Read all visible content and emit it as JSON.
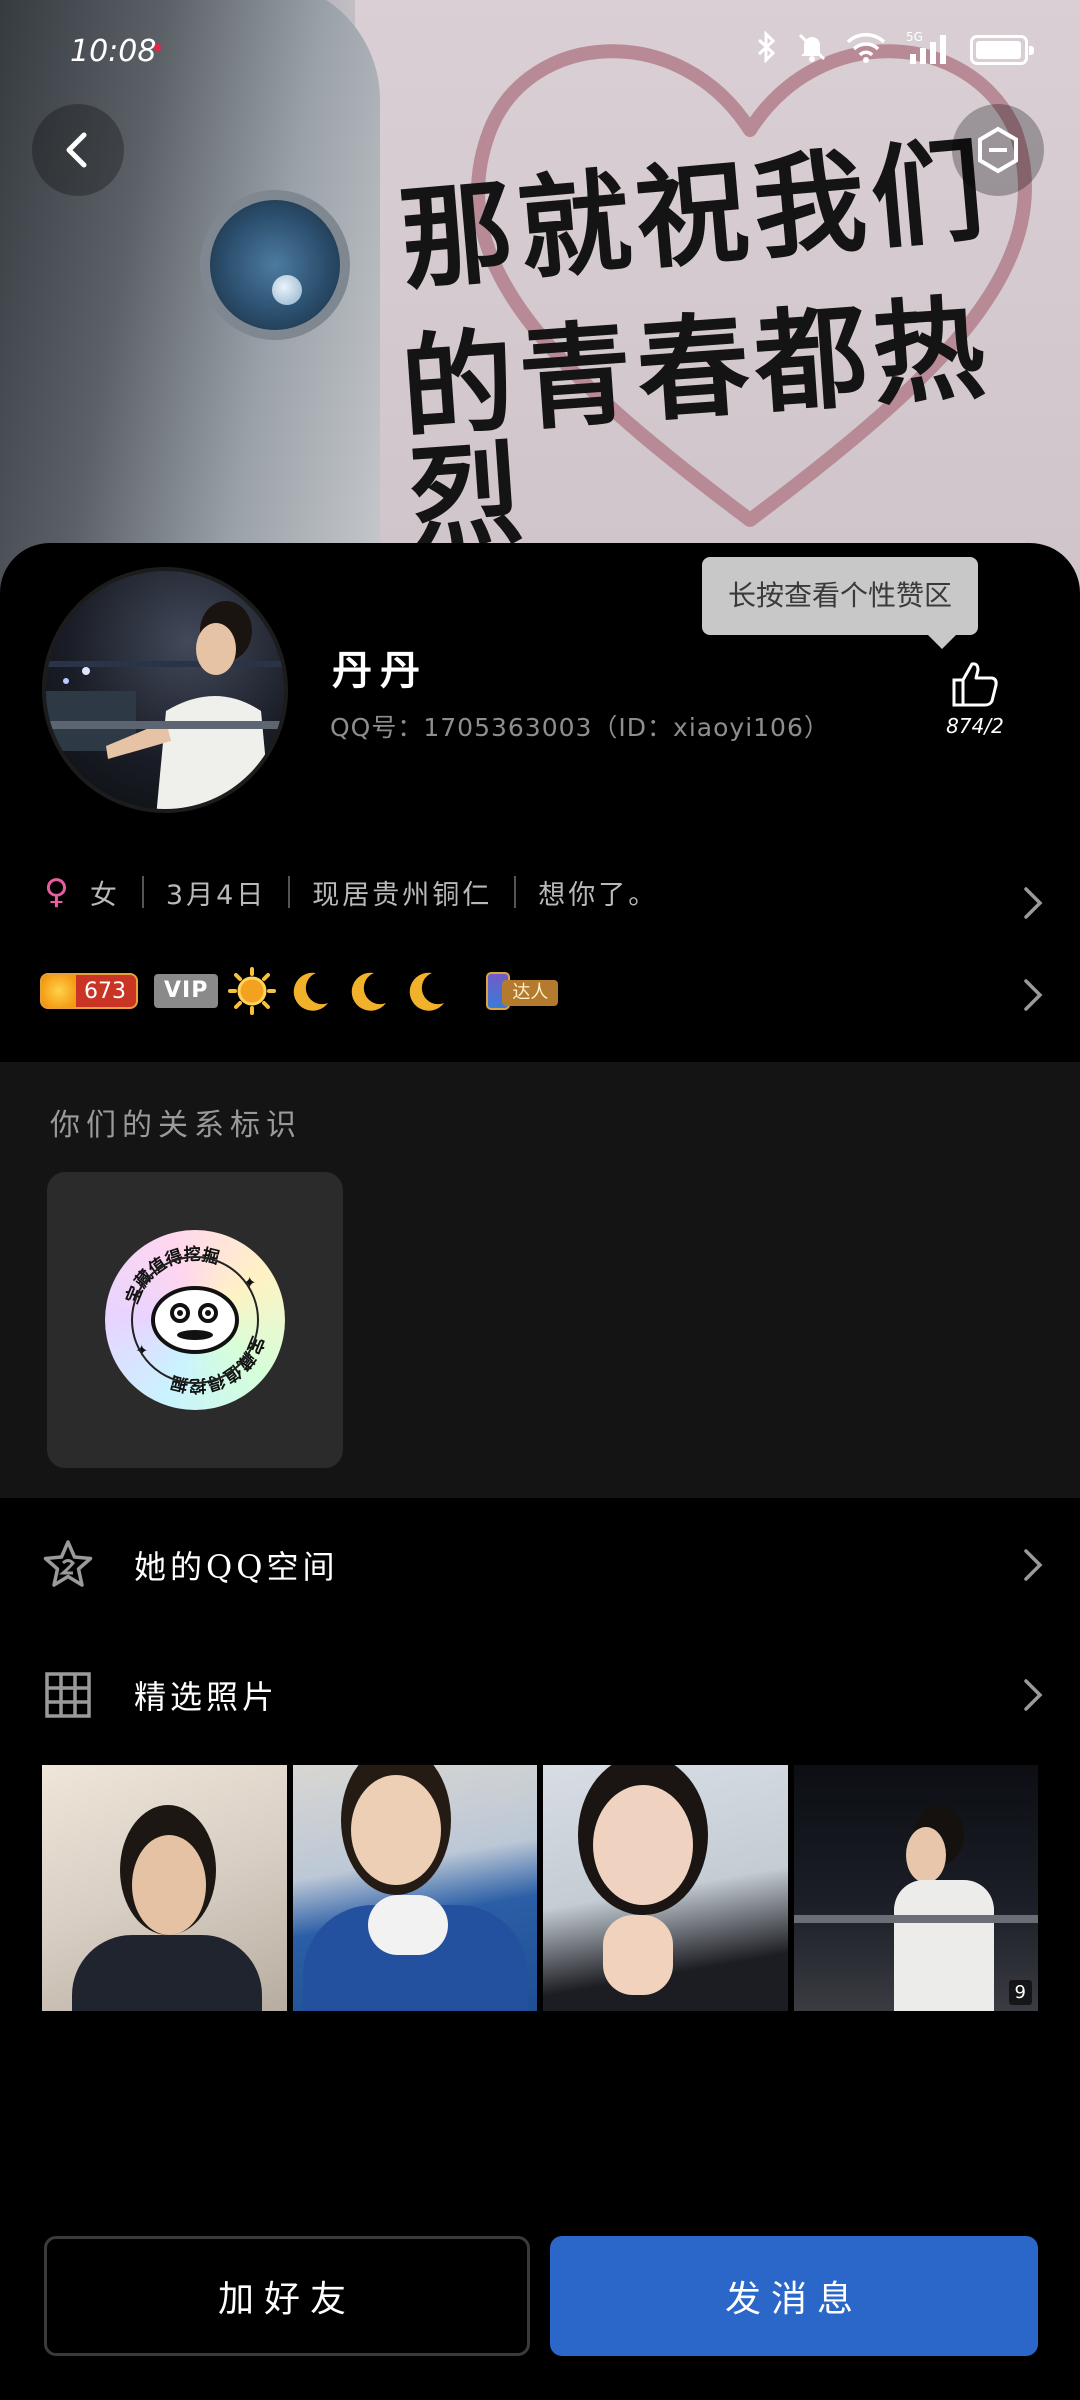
{
  "status_bar": {
    "time": "10:08",
    "network": "5G",
    "battery_level": 0.85
  },
  "cover": {
    "caption_line1": "那就祝我们",
    "caption_line2": "的青春都热烈"
  },
  "profile": {
    "name": "丹丹",
    "qq_line": "QQ号：1705363003（ID：xiaoyi106）",
    "like_tooltip": "长按查看个性赞区",
    "like_count": "874/2",
    "gender_symbol": "♀",
    "gender": "女",
    "birthday": "3月4日",
    "location": "现居贵州铜仁",
    "signature": "想你了。",
    "level_value": "673",
    "vip_label": "VIP",
    "daren_label": "达人"
  },
  "relation": {
    "title": "你们的关系标识",
    "badge_text": "宝藏值得挖掘"
  },
  "menu": {
    "qzone_label": "她的QQ空间",
    "photos_label": "精选照片",
    "photo_count": "9"
  },
  "actions": {
    "add_friend": "加好友",
    "send_message": "发消息"
  },
  "colors": {
    "primary_button": "#2b67c9",
    "tooltip_bg": "#c8c8c8",
    "gender": "#e85d9f"
  },
  "icons": [
    "back-arrow-icon",
    "hexagon-icon",
    "thumbs-up-icon",
    "chevron-right-icon",
    "star-icon",
    "grid-icon",
    "bluetooth-icon",
    "mute-icon",
    "wifi-icon",
    "signal-icon",
    "battery-icon",
    "sun-icon",
    "moon-icon"
  ]
}
